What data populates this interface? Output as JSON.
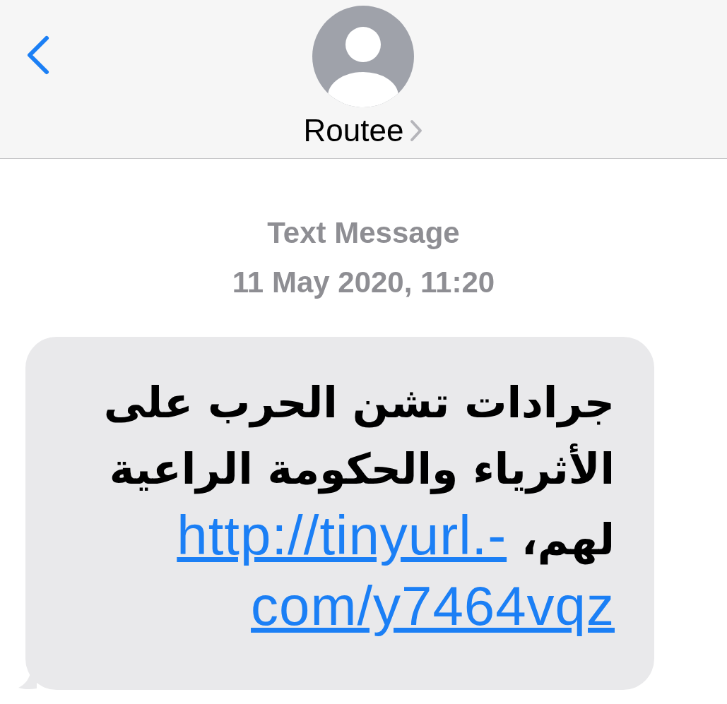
{
  "header": {
    "contact_name": "Routee"
  },
  "conversation": {
    "service_label": "Text Message",
    "timestamp": "11 May 2020, 11:20"
  },
  "message": {
    "text_lines": [
      "جرادات تشن الحرب على",
      "الأثرياء والحكومة الراعية",
      "لهم،"
    ],
    "link_lines": [
      "http://tinyurl.-",
      "com/y7464vqz"
    ]
  }
}
